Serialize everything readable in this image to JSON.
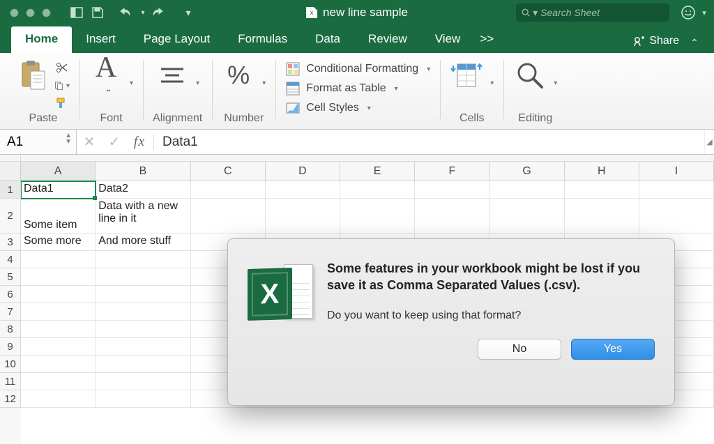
{
  "titlebar": {
    "document_title": "new line sample",
    "search_placeholder": "Search Sheet"
  },
  "ribbon_tabs": [
    "Home",
    "Insert",
    "Page Layout",
    "Formulas",
    "Data",
    "Review",
    "View"
  ],
  "ribbon_active_tab": "Home",
  "share_label": "Share",
  "ribbon_groups": {
    "clipboard": "Paste",
    "font": "Font",
    "alignment": "Alignment",
    "number": "Number",
    "cells": "Cells",
    "editing": "Editing"
  },
  "ribbon_styles": {
    "conditional": "Conditional Formatting",
    "table": "Format as Table",
    "cellstyles": "Cell Styles"
  },
  "name_box": "A1",
  "fx_label": "fx",
  "formula_value": "Data1",
  "columns": [
    "A",
    "B",
    "C",
    "D",
    "E",
    "F",
    "G",
    "H",
    "I"
  ],
  "row_numbers": [
    "1",
    "2",
    "3",
    "4",
    "5",
    "6",
    "7",
    "8",
    "9",
    "10",
    "11",
    "12"
  ],
  "grid": {
    "r1": {
      "A": "Data1",
      "B": "Data2"
    },
    "r2": {
      "A": "Some item",
      "B": "Data with a new line in it"
    },
    "r3": {
      "A": "Some more",
      "B": "And more stuff"
    }
  },
  "active_cell": "A1",
  "dialog": {
    "message_bold": "Some features in your workbook might be lost if you save it as Comma Separated Values (.csv).",
    "message_sub": "Do you want to keep using that format?",
    "no": "No",
    "yes": "Yes"
  }
}
